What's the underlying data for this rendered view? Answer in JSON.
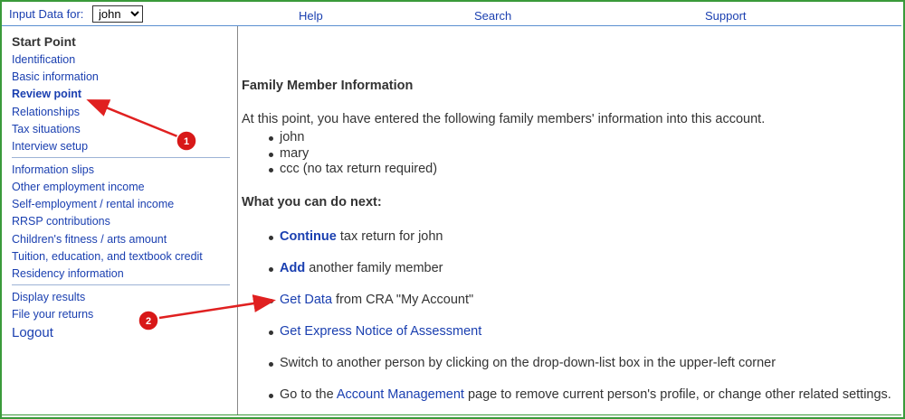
{
  "topbar": {
    "input_label": "Input Data for:",
    "person_selected": "john",
    "help": "Help",
    "search": "Search",
    "support": "Support"
  },
  "sidebar": {
    "heading": "Start Point",
    "group1": [
      "Identification",
      "Basic information",
      "Review point",
      "Relationships",
      "Tax situations",
      "Interview setup"
    ],
    "group2": [
      "Information slips",
      "Other employment income",
      "Self-employment / rental income",
      "RRSP contributions",
      "Children's fitness / arts amount",
      "Tuition, education, and textbook credit",
      "Residency information"
    ],
    "group3": [
      "Display results",
      "File your returns"
    ],
    "logout": "Logout"
  },
  "main": {
    "title": "Family Member Information",
    "intro": "At this point, you have entered the following family members' information into this account.",
    "members": [
      "john",
      "mary",
      "ccc (no tax return required)"
    ],
    "next_heading": "What you can do next:",
    "actions": {
      "continue_link": "Continue",
      "continue_rest": " tax return for john",
      "add_link": "Add",
      "add_rest": " another family member",
      "getdata_link": "Get Data",
      "getdata_rest": " from CRA \"My Account\"",
      "express_link": "Get Express Notice of Assessment",
      "switch_text": "Switch to another person by clicking on the drop-down-list box in the upper-left corner",
      "goto_pre": "Go to the ",
      "goto_link": "Account Management",
      "goto_post": " page to remove current person's profile, or change other related settings."
    }
  },
  "annotations": {
    "badge1": "1",
    "badge2": "2",
    "color": "#e02020"
  }
}
